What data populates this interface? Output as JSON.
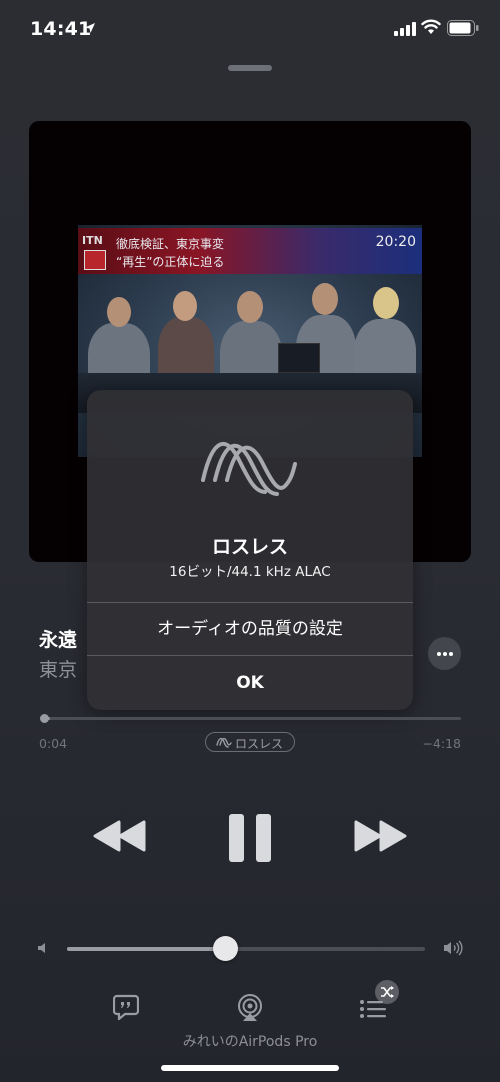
{
  "status_bar": {
    "time": "14:41"
  },
  "artwork": {
    "channel": "ITN",
    "headline_line1": "徹底検証、東京事変",
    "headline_line2": "“再生”の正体に迫る",
    "clock": "20:20"
  },
  "dialog": {
    "title": "ロスレス",
    "format": "16ビット/44.1 kHz ALAC",
    "quality_settings_label": "オーディオの品質の設定",
    "ok_label": "OK"
  },
  "track": {
    "title": "永遠",
    "artist": "東京",
    "more_icon": "ellipsis-icon"
  },
  "playback": {
    "elapsed": "0:04",
    "remaining": "−4:18",
    "progress_fraction": 0.015,
    "badge_label": "ロスレス"
  },
  "volume": {
    "level_fraction": 0.44
  },
  "output": {
    "device_name": "みれいのAirPods Pro"
  },
  "colors": {
    "background": "#2a2c33",
    "card": "#303034",
    "accent_text": "#8f9197"
  }
}
